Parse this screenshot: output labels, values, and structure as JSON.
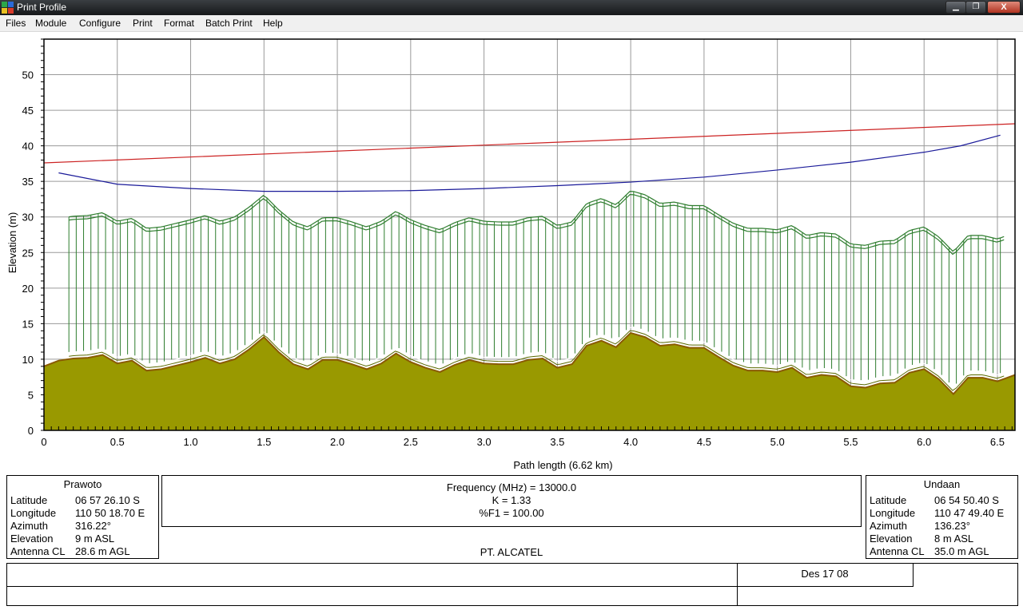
{
  "window": {
    "title": "Print Profile",
    "buttons": {
      "minimize": "▁",
      "maximize": "❐",
      "close": "X"
    }
  },
  "menu": [
    "Files",
    "Module",
    "Configure",
    "Print",
    "Format",
    "Batch Print",
    "Help"
  ],
  "chart_data": {
    "type": "area",
    "xlabel": "Path length (6.62 km)",
    "ylabel": "Elevation (m)",
    "xlim": [
      0,
      6.62
    ],
    "ylim": [
      0,
      55
    ],
    "x_ticks": [
      "0",
      "0.5",
      "1.0",
      "1.5",
      "2.0",
      "2.5",
      "3.0",
      "3.5",
      "4.0",
      "4.5",
      "5.0",
      "5.5",
      "6.0",
      "6.5"
    ],
    "y_ticks": [
      "0",
      "5",
      "10",
      "15",
      "20",
      "25",
      "30",
      "35",
      "40",
      "45",
      "50"
    ],
    "grid": true,
    "colors": {
      "terrain": "#999900",
      "terrain_edge": "#8a5a00",
      "clutter": "#2e7d2e",
      "los_line": "#cc2222",
      "fresnel_line": "#1a1a99"
    },
    "terrain": {
      "x": [
        0,
        0.1,
        0.2,
        0.3,
        0.4,
        0.5,
        0.6,
        0.7,
        0.8,
        0.9,
        1.0,
        1.1,
        1.2,
        1.3,
        1.4,
        1.5,
        1.6,
        1.7,
        1.8,
        1.9,
        2.0,
        2.1,
        2.2,
        2.3,
        2.4,
        2.5,
        2.6,
        2.7,
        2.8,
        2.9,
        3.0,
        3.1,
        3.2,
        3.3,
        3.4,
        3.5,
        3.6,
        3.7,
        3.8,
        3.9,
        4.0,
        4.1,
        4.2,
        4.3,
        4.4,
        4.5,
        4.6,
        4.7,
        4.8,
        4.9,
        5.0,
        5.1,
        5.2,
        5.3,
        5.4,
        5.5,
        5.6,
        5.7,
        5.8,
        5.9,
        6.0,
        6.1,
        6.2,
        6.3,
        6.4,
        6.5,
        6.62
      ],
      "y": [
        9.0,
        9.8,
        10.1,
        10.2,
        10.6,
        9.4,
        9.8,
        8.4,
        8.6,
        9.1,
        9.6,
        10.2,
        9.4,
        10.0,
        11.4,
        13.1,
        11.0,
        9.3,
        8.6,
        9.9,
        9.9,
        9.3,
        8.6,
        9.4,
        10.8,
        9.6,
        8.8,
        8.2,
        9.2,
        9.9,
        9.4,
        9.3,
        9.3,
        9.9,
        10.1,
        8.8,
        9.3,
        11.9,
        12.6,
        11.7,
        13.7,
        13.1,
        11.9,
        12.1,
        11.6,
        11.6,
        10.3,
        9.1,
        8.4,
        8.4,
        8.2,
        8.8,
        7.4,
        7.8,
        7.6,
        6.2,
        6.0,
        6.6,
        6.7,
        8.1,
        8.6,
        7.2,
        5.1,
        7.4,
        7.4,
        6.9,
        7.8
      ]
    },
    "clutter": {
      "x_start": 0.17,
      "x_end": 6.55,
      "height_m": 20,
      "bar_spacing_km": 0.05
    },
    "series": [
      {
        "name": "",
        "x": [
          0,
          6.62
        ],
        "y": [
          37.6,
          43.1
        ]
      },
      {
        "name": "",
        "x": [
          0.1,
          0.5,
          1.0,
          1.5,
          2.0,
          2.5,
          3.0,
          3.5,
          4.0,
          4.5,
          5.0,
          5.5,
          6.0,
          6.25,
          6.52
        ],
        "y": [
          36.2,
          34.6,
          34.0,
          33.6,
          33.6,
          33.7,
          34.0,
          34.4,
          34.9,
          35.6,
          36.6,
          37.7,
          39.1,
          40.0,
          41.5
        ]
      }
    ]
  },
  "site_left": {
    "name": "Prawoto",
    "rows": [
      {
        "label": "Latitude",
        "value": "06 57 26.10 S"
      },
      {
        "label": "Longitude",
        "value": "110 50 18.70 E"
      },
      {
        "label": "Azimuth",
        "value": "316.22°"
      },
      {
        "label": "Elevation",
        "value": "9 m ASL"
      },
      {
        "label": "Antenna CL",
        "value": "28.6 m AGL"
      }
    ]
  },
  "site_right": {
    "name": "Undaan",
    "rows": [
      {
        "label": "Latitude",
        "value": "06 54 50.40 S"
      },
      {
        "label": "Longitude",
        "value": "110 47 49.40 E"
      },
      {
        "label": "Azimuth",
        "value": "136.23°"
      },
      {
        "label": "Elevation",
        "value": "8 m ASL"
      },
      {
        "label": "Antenna CL",
        "value": "35.0 m AGL"
      }
    ]
  },
  "link": {
    "frequency": "Frequency (MHz) = 13000.0",
    "k": "K = 1.33",
    "f1": "%F1 = 100.00"
  },
  "company": "PT. ALCATEL",
  "footer": {
    "date": "Des 17 08"
  }
}
